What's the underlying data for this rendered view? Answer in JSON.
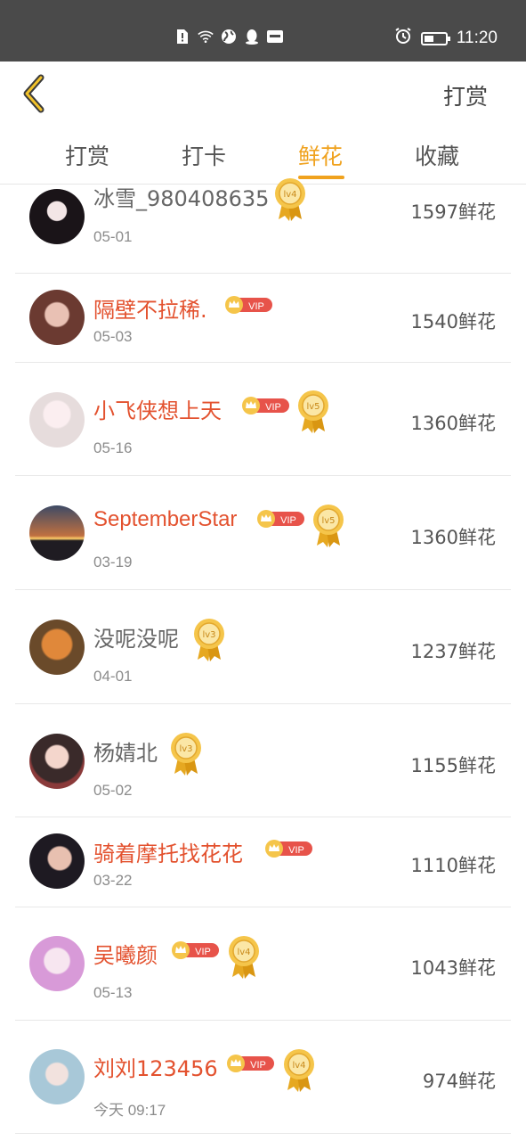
{
  "status_bar": {
    "time": "11:20",
    "battery_level": 0.45,
    "icons": [
      "sim-alert-icon",
      "wifi-icon",
      "globe-icon",
      "qq-icon",
      "hms-icon"
    ]
  },
  "header": {
    "back_icon": "chevron-left-icon",
    "right_label": "打赏"
  },
  "tabs": [
    {
      "label": "打赏",
      "active": false
    },
    {
      "label": "打卡",
      "active": false
    },
    {
      "label": "鲜花",
      "active": true
    },
    {
      "label": "收藏",
      "active": false
    }
  ],
  "colors": {
    "accent": "#f0a21e",
    "vip_name": "#e3522f",
    "vip_badge": "#e7534a"
  },
  "list": [
    {
      "name": "冰雪_980408635",
      "vip": false,
      "level": "lv4",
      "date": "05-01",
      "amount": "1597鲜花"
    },
    {
      "name": "隔壁不拉稀.",
      "vip": true,
      "level": null,
      "date": "05-03",
      "amount": "1540鲜花"
    },
    {
      "name": "小飞侠想上天",
      "vip": true,
      "level": "lv5",
      "date": "05-16",
      "amount": "1360鲜花"
    },
    {
      "name": "SeptemberStar",
      "vip": true,
      "level": "lv5",
      "date": "03-19",
      "amount": "1360鲜花"
    },
    {
      "name": "没呢没呢",
      "vip": false,
      "level": "lv3",
      "date": "04-01",
      "amount": "1237鲜花"
    },
    {
      "name": "杨婧北",
      "vip": false,
      "level": "lv3",
      "date": "05-02",
      "amount": "1155鲜花"
    },
    {
      "name": "骑着摩托找花花",
      "vip": true,
      "level": null,
      "date": "03-22",
      "amount": "1110鲜花"
    },
    {
      "name": "吴曦颜",
      "vip": true,
      "level": "lv4",
      "date": "05-13",
      "amount": "1043鲜花"
    },
    {
      "name": "刘刘123456",
      "vip": true,
      "level": "lv4",
      "date": "今天 09:17",
      "amount": "974鲜花"
    }
  ],
  "vip_label": "VIP"
}
